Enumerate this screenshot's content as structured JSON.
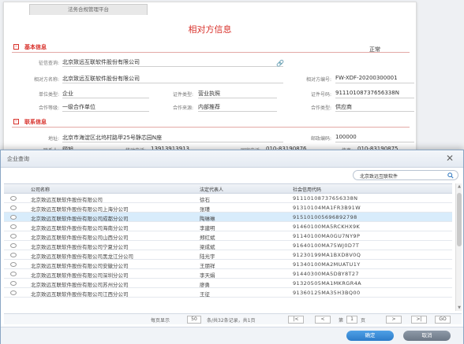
{
  "bg": {
    "tab_label": "法务合规管理平台",
    "title": "相对方信息",
    "status": "正常",
    "section_basic": "基本信息",
    "section_contact": "联系信息",
    "fields": {
      "credit_query_label": "征信查询:",
      "credit_query_value": "北京致远互联软件股份有限公司",
      "party_name_label": "相对方名称:",
      "party_name_value": "北京致远互联软件股份有限公司",
      "party_code_label": "相对方编号:",
      "party_code_value": "FW-XDF-20200300001",
      "unit_type_label": "单位类型:",
      "unit_type_value": "企业",
      "cert_type_label": "证件类型:",
      "cert_type_value": "营业执照",
      "cert_no_label": "证件号码:",
      "cert_no_value": "91110108737656338N",
      "coop_level_label": "合作等级:",
      "coop_level_value": "一级合作单位",
      "coop_source_label": "合作来源:",
      "coop_source_value": "内部推荐",
      "coop_type_label": "合作类型:",
      "coop_type_value": "供应商",
      "address_label": "地址:",
      "address_value": "北京市海淀区北坞村路甲25号静芯园N座",
      "postcode_label": "邮政编码:",
      "postcode_value": "100000",
      "contact_label": "联系人:",
      "contact_value": "顾旭",
      "mobile_label": "移动电话:",
      "mobile_value": "13913913913",
      "phone_label": "固定电话:",
      "phone_value": "010-83190876",
      "fax_label": "传真:",
      "fax_value": "010-83190875"
    }
  },
  "dialog": {
    "title": "企业查询",
    "search_value": "北京致远互联软件",
    "columns": [
      "公司名称",
      "法定代表人",
      "社会信用代码"
    ],
    "rows": [
      {
        "name": "北京致远互联软件股份有限公司",
        "rep": "徐石",
        "code": "91110108737656338N",
        "selected": false
      },
      {
        "name": "北京致远互联软件股份有限公司上海分公司",
        "rep": "张瑾",
        "code": "91310104MA1FR3B91W",
        "selected": false
      },
      {
        "name": "北京致远互联软件股份有限公司成都分公司",
        "rep": "陶琳琳",
        "code": "915101005696892798",
        "selected": true
      },
      {
        "name": "北京致远互联软件股份有限公司海南分公司",
        "rep": "李建明",
        "code": "91460100MA5RCKHX9K",
        "selected": false
      },
      {
        "name": "北京致远互联软件股份有限公司山西分公司",
        "rep": "郑红斌",
        "code": "91140100MA0GU7NY9P",
        "selected": false
      },
      {
        "name": "北京致远互联软件股份有限公司宁夏分公司",
        "rep": "梁成斌",
        "code": "91640100MA75WJ0D7T",
        "selected": false
      },
      {
        "name": "北京致远互联软件股份有限公司黑龙江分公司",
        "rep": "陆光宇",
        "code": "91230199MA1BXD8V0Q",
        "selected": false
      },
      {
        "name": "北京致远互联软件股份有限公司安徽分公司",
        "rep": "王朋祥",
        "code": "91340100MA2MUATU1Y",
        "selected": false
      },
      {
        "name": "北京致远互联软件股份有限公司深圳分公司",
        "rep": "李天娟",
        "code": "91440300MA5DBY8T27",
        "selected": false
      },
      {
        "name": "北京致远互联软件股份有限公司苏州分公司",
        "rep": "廖勇",
        "code": "91320505MA1MKRGR4A",
        "selected": false
      },
      {
        "name": "北京致远互联软件股份有限公司江西分公司",
        "rep": "王征",
        "code": "91360125MA35H3BQ00",
        "selected": false
      }
    ],
    "pager": {
      "per_page_label": "每页显示",
      "per_page_value": "50",
      "summary": "条/共32条记录，共1页",
      "first": "|<",
      "prev": "<",
      "page_prefix": "第",
      "page_value": "1",
      "page_suffix": "页",
      "next": ">",
      "last": ">|",
      "go": "GO"
    },
    "ok_label": "确定",
    "cancel_label": "取消"
  }
}
